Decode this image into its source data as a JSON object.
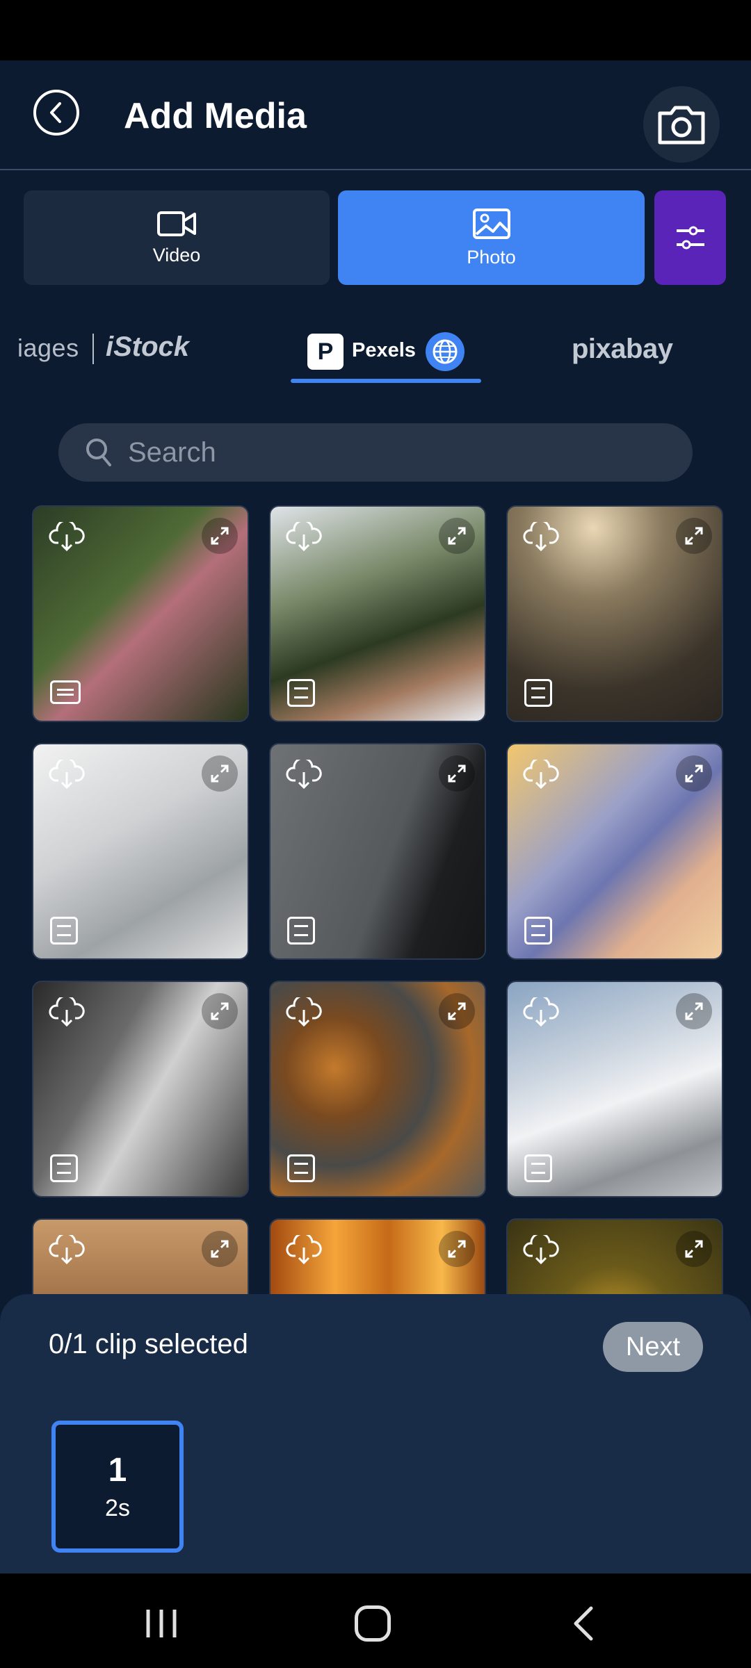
{
  "header": {
    "title": "Add Media"
  },
  "tabs": {
    "video_label": "Video",
    "photo_label": "Photo"
  },
  "providers": {
    "images_label": "iages",
    "istock_label": "iStock",
    "pexels_label": "Pexels",
    "pixabay_label": "pixabay"
  },
  "search": {
    "placeholder": "Search"
  },
  "selection": {
    "count_text": "0/1 clip selected",
    "next_label": "Next"
  },
  "clip": {
    "number": "1",
    "duration": "2s"
  },
  "colors": {
    "accent": "#3f84f2",
    "filter": "#5a24b8",
    "background": "#0c1b30",
    "panel": "#182b47"
  }
}
